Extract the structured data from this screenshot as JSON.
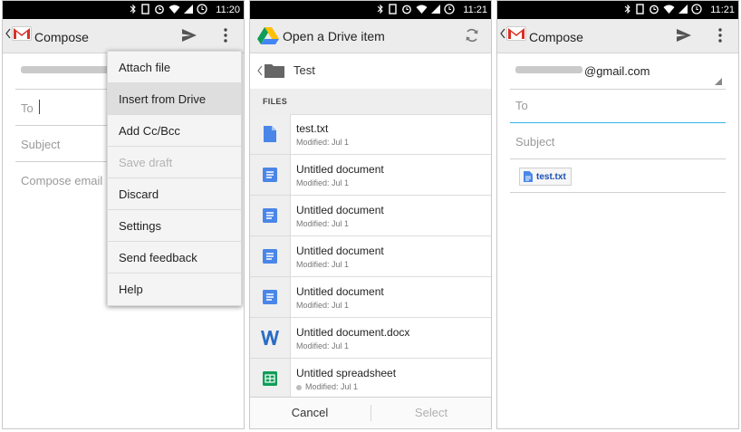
{
  "panel1": {
    "status": {
      "time": "11:20"
    },
    "actionbar": {
      "title": "Compose"
    },
    "form": {
      "to_label": "To",
      "subject_placeholder": "Subject",
      "body_placeholder": "Compose email"
    },
    "menu": {
      "items": [
        {
          "label": "Attach file",
          "state": "normal"
        },
        {
          "label": "Insert from Drive",
          "state": "pressed"
        },
        {
          "label": "Add Cc/Bcc",
          "state": "normal"
        },
        {
          "label": "Save draft",
          "state": "disabled"
        },
        {
          "label": "Discard",
          "state": "normal"
        },
        {
          "label": "Settings",
          "state": "normal"
        },
        {
          "label": "Send feedback",
          "state": "normal"
        },
        {
          "label": "Help",
          "state": "normal"
        }
      ]
    }
  },
  "panel2": {
    "status": {
      "time": "11:21"
    },
    "actionbar": {
      "title": "Open a Drive item"
    },
    "breadcrumb": {
      "folder": "Test"
    },
    "files_header": "FILES",
    "files": [
      {
        "name": "test.txt",
        "modified": "Modified: Jul 1",
        "icon": "text-file-icon"
      },
      {
        "name": "Untitled document",
        "modified": "Modified: Jul 1",
        "icon": "document-icon"
      },
      {
        "name": "Untitled document",
        "modified": "Modified: Jul 1",
        "icon": "document-icon"
      },
      {
        "name": "Untitled document",
        "modified": "Modified: Jul 1",
        "icon": "document-icon"
      },
      {
        "name": "Untitled document",
        "modified": "Modified: Jul 1",
        "icon": "document-icon"
      },
      {
        "name": "Untitled document.docx",
        "modified": "Modified: Jul 1",
        "icon": "word-icon"
      },
      {
        "name": "Untitled spreadsheet",
        "modified": "Modified: Jul 1",
        "icon": "spreadsheet-icon"
      }
    ],
    "buttons": {
      "cancel": "Cancel",
      "select": "Select"
    }
  },
  "panel3": {
    "status": {
      "time": "11:21"
    },
    "actionbar": {
      "title": "Compose"
    },
    "from": {
      "visible_suffix": "@gmail.com"
    },
    "form": {
      "to_placeholder": "To",
      "subject_placeholder": "Subject"
    },
    "attachment": {
      "name": "test.txt"
    }
  },
  "colors": {
    "gmail_red": "#d93025",
    "doc_blue": "#4a86e8",
    "sheet_green": "#0f9d58",
    "word_blue": "#2b6cc4",
    "focus_blue": "#33b5e5"
  }
}
